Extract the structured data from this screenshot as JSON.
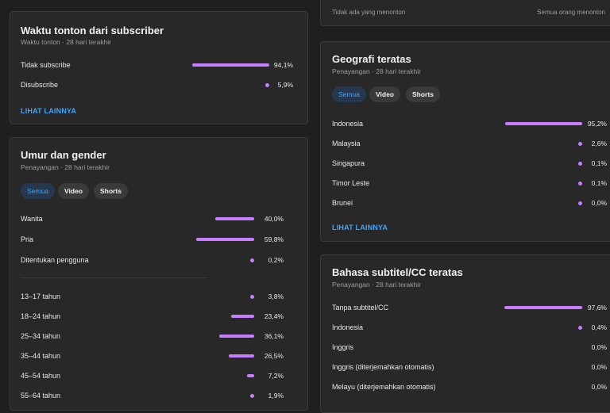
{
  "subscriber_card": {
    "title": "Waktu tonton dari subscriber",
    "subtitle": "Waktu tonton · 28 hari terakhir",
    "rows": [
      {
        "label": "Tidak subscribe",
        "value": "94,1%",
        "fraction": 0.941
      },
      {
        "label": "Disubscribe",
        "value": "5,9%",
        "fraction": 0.059
      }
    ],
    "more_link": "LIHAT LAINNYA"
  },
  "age_gender_card": {
    "title": "Umur dan gender",
    "subtitle": "Penayangan · 28 hari terakhir",
    "chips": [
      "Semua",
      "Video",
      "Shorts"
    ],
    "gender_rows": [
      {
        "label": "Wanita",
        "value": "40,0%",
        "fraction": 0.4
      },
      {
        "label": "Pria",
        "value": "59,8%",
        "fraction": 0.598
      },
      {
        "label": "Ditentukan pengguna",
        "value": "0,2%",
        "fraction": 0.002
      }
    ],
    "age_rows": [
      {
        "label": "13–17 tahun",
        "value": "3,8%",
        "fraction": 0.038
      },
      {
        "label": "18–24 tahun",
        "value": "23,4%",
        "fraction": 0.234
      },
      {
        "label": "25–34 tahun",
        "value": "36,1%",
        "fraction": 0.361
      },
      {
        "label": "35–44 tahun",
        "value": "26,5%",
        "fraction": 0.265
      },
      {
        "label": "45–54 tahun",
        "value": "7,2%",
        "fraction": 0.072
      },
      {
        "label": "55–64 tahun",
        "value": "1,9%",
        "fraction": 0.019
      }
    ]
  },
  "top_strip": {
    "left_note": "Tidak ada yang menonton",
    "right_note": "Semua orang menonton"
  },
  "geo_card": {
    "title": "Geografi teratas",
    "subtitle": "Penayangan · 28 hari terakhir",
    "chips": [
      "Semua",
      "Video",
      "Shorts"
    ],
    "rows": [
      {
        "label": "Indonesia",
        "value": "95,2%",
        "fraction": 0.952
      },
      {
        "label": "Malaysia",
        "value": "2,6%",
        "fraction": 0.026
      },
      {
        "label": "Singapura",
        "value": "0,1%",
        "fraction": 0.001
      },
      {
        "label": "Timor Leste",
        "value": "0,1%",
        "fraction": 0.001
      },
      {
        "label": "Brunei",
        "value": "0,0%",
        "fraction": 0.0
      }
    ],
    "more_link": "LIHAT LAINNYA"
  },
  "subtitle_card": {
    "title": "Bahasa subtitel/CC teratas",
    "subtitle": "Penayangan · 28 hari terakhir",
    "rows": [
      {
        "label": "Tanpa subtitel/CC",
        "value": "97,6%",
        "fraction": 0.976
      },
      {
        "label": "Indonesia",
        "value": "0,4%",
        "fraction": 0.004
      },
      {
        "label": "Inggris",
        "value": "0,0%",
        "fraction": 0.0
      },
      {
        "label": "Inggris (diterjemahkan otomatis)",
        "value": "0,0%",
        "fraction": 0.0
      },
      {
        "label": "Melayu (diterjemahkan otomatis)",
        "value": "0,0%",
        "fraction": 0.0
      }
    ]
  },
  "colors": {
    "bar": "#c77dff",
    "link": "#3ea6ff",
    "chip_active_bg": "#263850"
  }
}
